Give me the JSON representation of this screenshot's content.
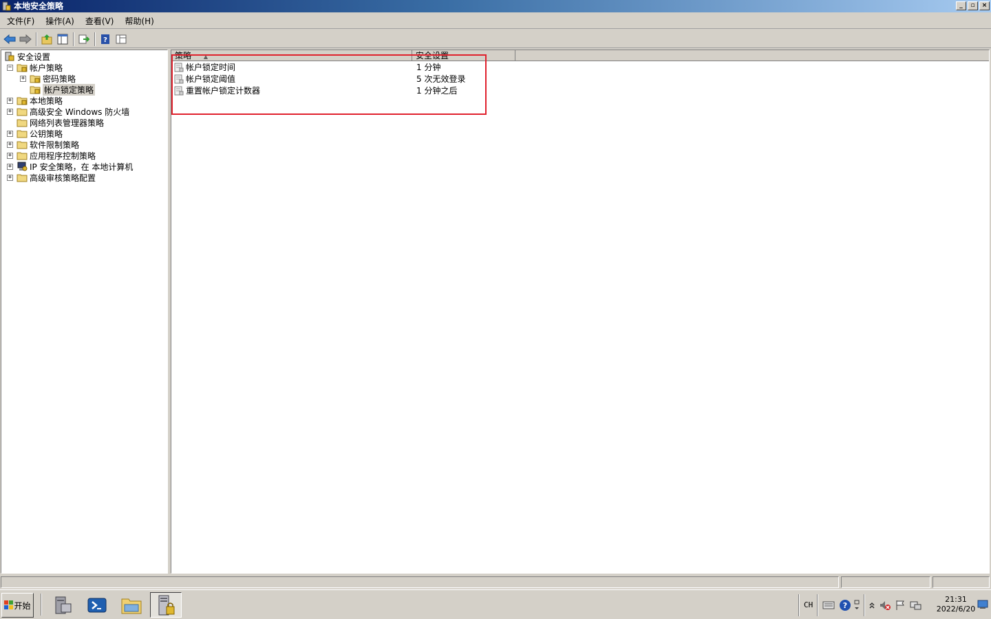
{
  "window": {
    "title": "本地安全策略"
  },
  "menu": [
    {
      "label": "文件(F)"
    },
    {
      "label": "操作(A)"
    },
    {
      "label": "查看(V)"
    },
    {
      "label": "帮助(H)"
    }
  ],
  "toolbar": {
    "buttons": [
      "back-arrow-icon",
      "forward-arrow-icon",
      "up-folder-icon",
      "show-tree-icon",
      "export-list-icon",
      "help-icon",
      "console-icon"
    ]
  },
  "tree": {
    "root": "安全设置",
    "items": [
      {
        "label": "帐户策略",
        "expander": "-"
      },
      {
        "label": "密码策略",
        "expander": "+"
      },
      {
        "label": "帐户锁定策略",
        "expander": "",
        "selected": true
      },
      {
        "label": "本地策略",
        "expander": "+"
      },
      {
        "label": "高级安全 Windows 防火墙",
        "expander": "+"
      },
      {
        "label": "网络列表管理器策略",
        "expander": ""
      },
      {
        "label": "公钥策略",
        "expander": "+"
      },
      {
        "label": "软件限制策略",
        "expander": "+"
      },
      {
        "label": "应用程序控制策略",
        "expander": "+"
      },
      {
        "label": "IP 安全策略，在 本地计算机",
        "expander": "+"
      },
      {
        "label": "高级审核策略配置",
        "expander": "+"
      }
    ]
  },
  "list": {
    "columns": [
      "策略",
      "安全设置"
    ],
    "rows": [
      {
        "policy": "帐户锁定时间",
        "setting": "1 分钟"
      },
      {
        "policy": "帐户锁定阈值",
        "setting": "5 次无效登录"
      },
      {
        "policy": "重置帐户锁定计数器",
        "setting": "1 分钟之后"
      }
    ]
  },
  "taskbar": {
    "start_label": "开始",
    "tray": {
      "lang": "CH"
    },
    "clock": {
      "time": "21:31",
      "date": "2022/6/20"
    }
  },
  "colors": {
    "highlight": "#e0202c",
    "titlebar": "#0a246a"
  }
}
